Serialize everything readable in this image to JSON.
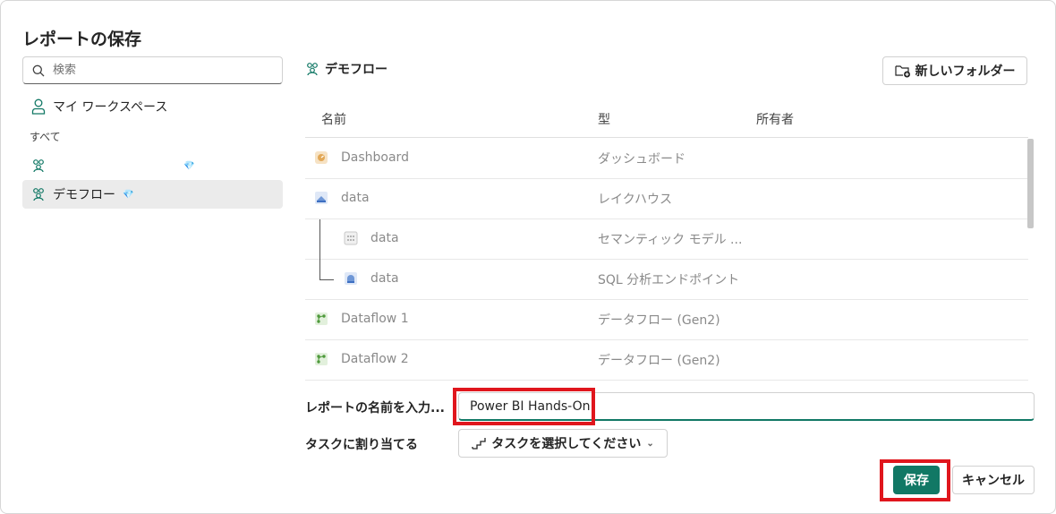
{
  "dialog": {
    "title": "レポートの保存"
  },
  "sidebar": {
    "search_placeholder": "検索",
    "my_workspace": "マイ ワークスペース",
    "section_all": "すべて",
    "workspaces": [
      {
        "label": "",
        "premium_icon": "diamond-icon"
      },
      {
        "label": "デモフロー",
        "premium_icon": "diamond-icon",
        "selected": true
      }
    ]
  },
  "main": {
    "breadcrumb": "デモフロー",
    "new_folder_label": "新しいフォルダー",
    "columns": {
      "name": "名前",
      "type": "型",
      "owner": "所有者"
    },
    "rows": [
      {
        "name": "Dashboard",
        "type": "ダッシュボード",
        "icon": "dashboard-icon"
      },
      {
        "name": "data",
        "type": "レイクハウス",
        "icon": "lakehouse-icon"
      },
      {
        "name": "data",
        "type": "セマンティック モデル ...",
        "icon": "semantic-model-icon",
        "child": true
      },
      {
        "name": "data",
        "type": "SQL 分析エンドポイント",
        "icon": "sql-endpoint-icon",
        "child": true
      },
      {
        "name": "Dataflow 1",
        "type": "データフロー (Gen2)",
        "icon": "dataflow-icon"
      },
      {
        "name": "Dataflow 2",
        "type": "データフロー (Gen2)",
        "icon": "dataflow-icon"
      }
    ]
  },
  "form": {
    "name_label": "レポートの名前を入力...",
    "name_value": "Power BI Hands-On",
    "task_label": "タスクに割り当てる",
    "task_button": "タスクを選択してください"
  },
  "footer": {
    "save": "保存",
    "cancel": "キャンセル"
  },
  "colors": {
    "accent": "#117865",
    "highlight": "#e0161d",
    "workspace_icon": "#117865"
  }
}
